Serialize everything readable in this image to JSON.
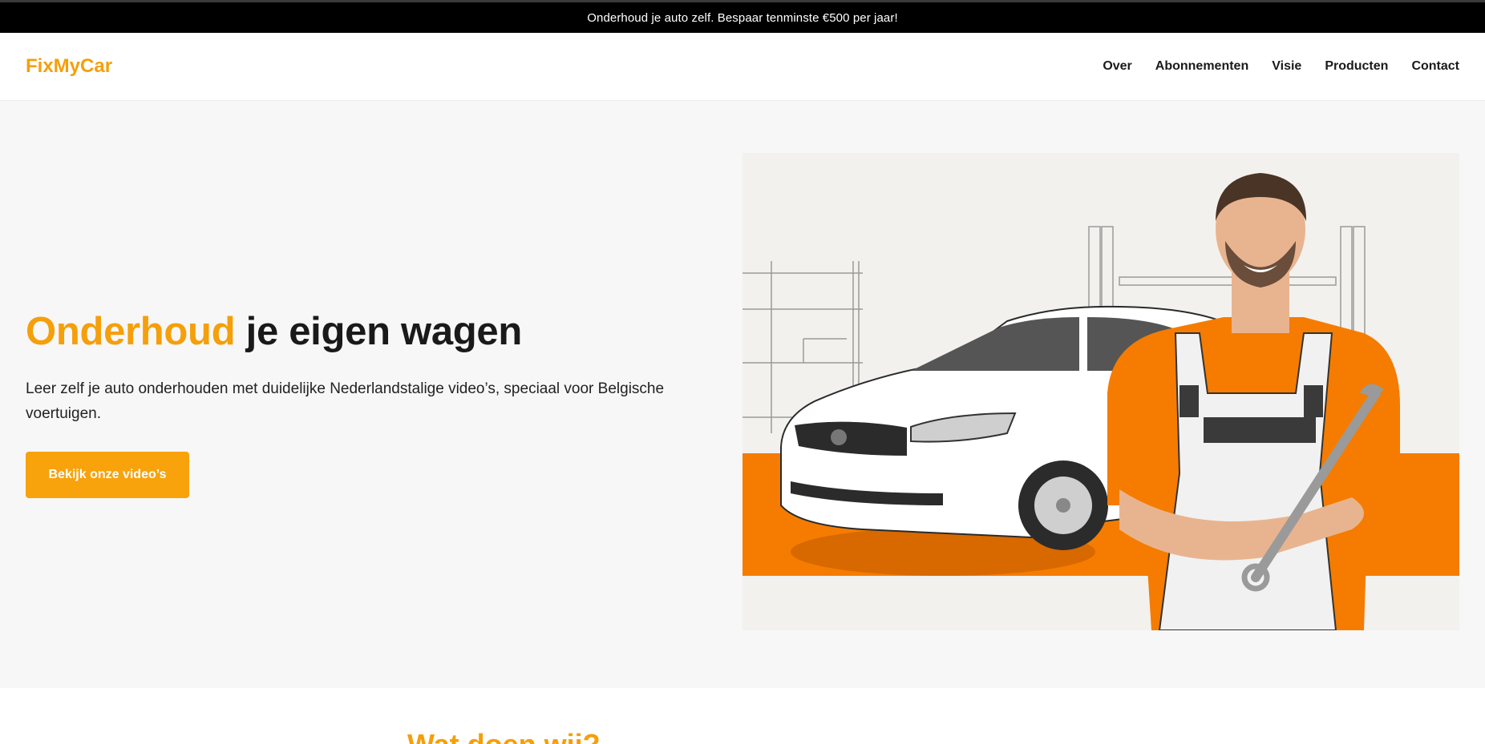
{
  "announcement": {
    "text": "Onderhoud je auto zelf. Bespaar tenminste €500 per jaar!"
  },
  "header": {
    "logo": "FixMyCar",
    "nav": [
      "Over",
      "Abonnementen",
      "Visie",
      "Producten",
      "Contact"
    ]
  },
  "hero": {
    "title_accent": "Onderhoud",
    "title_rest": " je eigen wagen",
    "subtitle": "Leer zelf je auto onderhouden met duidelijke Nederlandstalige video’s, speciaal voor Belgische voertuigen.",
    "cta": "Bekijk onze video’s",
    "image": "hero-car-mechanic-illustration"
  },
  "next_section": {
    "title_partial": "Wat doen wij?"
  },
  "colors": {
    "accent": "#f59f0b",
    "button": "#f8a20c",
    "orange_band": "#f57c00",
    "announcement_bg": "#000000"
  }
}
